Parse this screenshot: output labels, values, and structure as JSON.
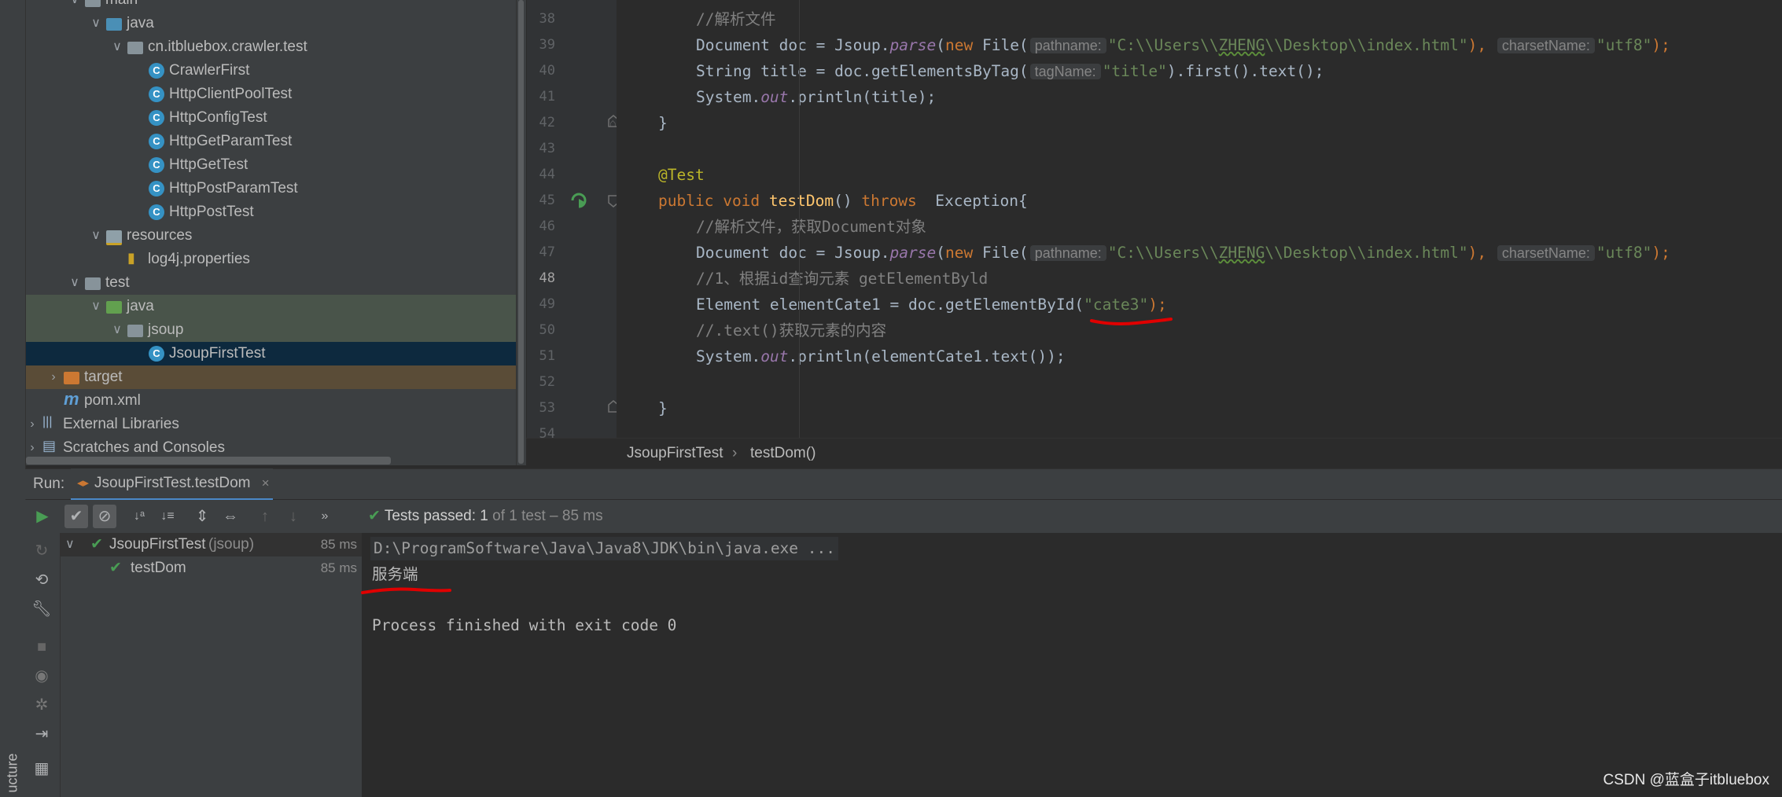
{
  "side_strip": {
    "label": "ucture"
  },
  "tree": [
    {
      "label": "main",
      "level": 3,
      "icon": "folder-icon",
      "arrow": "expanded"
    },
    {
      "label": "java",
      "level": 4,
      "icon": "source-folder-icon",
      "arrow": "expanded"
    },
    {
      "label": "cn.itbluebox.crawler.test",
      "level": 5,
      "icon": "package-icon",
      "arrow": "expanded"
    },
    {
      "label": "CrawlerFirst",
      "level": 6,
      "icon": "class-icon",
      "arrow": "none"
    },
    {
      "label": "HttpClientPoolTest",
      "level": 6,
      "icon": "class-icon",
      "arrow": "none"
    },
    {
      "label": "HttpConfigTest",
      "level": 6,
      "icon": "class-icon",
      "arrow": "none"
    },
    {
      "label": "HttpGetParamTest",
      "level": 6,
      "icon": "class-icon",
      "arrow": "none"
    },
    {
      "label": "HttpGetTest",
      "level": 6,
      "icon": "class-icon",
      "arrow": "none"
    },
    {
      "label": "HttpPostParamTest",
      "level": 6,
      "icon": "class-icon",
      "arrow": "none"
    },
    {
      "label": "HttpPostTest",
      "level": 6,
      "icon": "class-icon",
      "arrow": "none"
    },
    {
      "label": "resources",
      "level": 4,
      "icon": "resources-folder-icon",
      "arrow": "expanded"
    },
    {
      "label": "log4j.properties",
      "level": 5,
      "icon": "properties-file-icon",
      "arrow": "none"
    },
    {
      "label": "test",
      "level": 3,
      "icon": "folder-icon",
      "arrow": "expanded"
    },
    {
      "label": "java",
      "level": 4,
      "icon": "test-source-folder-icon",
      "arrow": "expanded"
    },
    {
      "label": "jsoup",
      "level": 5,
      "icon": "package-icon",
      "arrow": "expanded"
    },
    {
      "label": "JsoupFirstTest",
      "level": 6,
      "icon": "test-class-icon",
      "arrow": "none"
    },
    {
      "label": "target",
      "level": 2,
      "icon": "excluded-folder-icon",
      "arrow": "collapsed"
    },
    {
      "label": "pom.xml",
      "level": 2,
      "icon": "maven-icon",
      "arrow": "none"
    },
    {
      "label": "External Libraries",
      "level": 1,
      "icon": "libraries-icon",
      "arrow": "collapsed"
    },
    {
      "label": "Scratches and Consoles",
      "level": 1,
      "icon": "scratches-icon",
      "arrow": "collapsed"
    }
  ],
  "editor": {
    "line_numbers": [
      "38",
      "39",
      "40",
      "41",
      "42",
      "43",
      "44",
      "45",
      "46",
      "47",
      "48",
      "49",
      "50",
      "51",
      "52",
      "53",
      "54"
    ],
    "lines": {
      "l38": {
        "comment": "//解析文件"
      },
      "l39": {
        "a": "Document doc = Jsoup.",
        "parse": "parse",
        "b": "(",
        "new": "new",
        "c": " File(",
        "hint1": "pathname:",
        "s1a": "\"C:\\\\Users\\\\",
        "s1b": "ZHENG",
        "s1c": "\\\\Desktop\\\\index.html\"",
        "d": "),",
        "hint2": "charsetName:",
        "s2": "\"utf8\"",
        "e": ");"
      },
      "l40": {
        "a": "String title = doc.getElementsByTag(",
        "hint": "tagName:",
        "s": "\"title\"",
        "b": ").first().text();"
      },
      "l41": {
        "a": "System.",
        "out": "out",
        "b": ".println(title);"
      },
      "l42": {
        "a": "}"
      },
      "l44": {
        "ann": "@Test"
      },
      "l45": {
        "kw1": "public",
        "kw2": "void",
        "fn": "testDom",
        "a": "()",
        "kw3": "throws",
        "b": " Exception{"
      },
      "l46": {
        "comment": "//解析文件，获取Document对象"
      },
      "l47": {
        "a": "Document doc = Jsoup.",
        "parse": "parse",
        "b": "(",
        "new": "new",
        "c": " File(",
        "hint1": "pathname:",
        "s1a": "\"C:\\\\Users\\\\",
        "s1b": "ZHENG",
        "s1c": "\\\\Desktop\\\\index.html\"",
        "d": "),",
        "hint2": "charsetName:",
        "s2": "\"utf8\"",
        "e": ");"
      },
      "l48": {
        "comment": "//1、根据id查询元素 getElementByld"
      },
      "l49": {
        "a": "Element elementCate1 = doc.getElementById(",
        "s": "\"cate3\"",
        "b": ");"
      },
      "l50": {
        "comment": "//.text()获取元素的内容"
      },
      "l51": {
        "a": "System.",
        "out": "out",
        "b": ".println(elementCate1.text());"
      },
      "l53": {
        "a": "}"
      }
    }
  },
  "breadcrumb": {
    "class_name": "JsoupFirstTest",
    "method_name": "testDom()"
  },
  "run": {
    "label": "Run:",
    "tab_title": "JsoupFirstTest.testDom",
    "status_strong": "Tests passed: 1",
    "status_rest": "of 1 test – 85 ms",
    "tree": {
      "root_label": "JsoupFirstTest",
      "root_pkg": "(jsoup)",
      "root_time": "85 ms",
      "child_label": "testDom",
      "child_time": "85 ms"
    },
    "console": {
      "command": "D:\\ProgramSoftware\\Java\\Java8\\JDK\\bin\\java.exe ...",
      "output": "服务端",
      "exit": "Process finished with exit code 0"
    }
  },
  "watermark": "CSDN @蓝盒子itbluebox",
  "colors": {
    "accent": "#4a88c7",
    "pass_green": "#499c54",
    "annotation_red": "#e00000"
  }
}
